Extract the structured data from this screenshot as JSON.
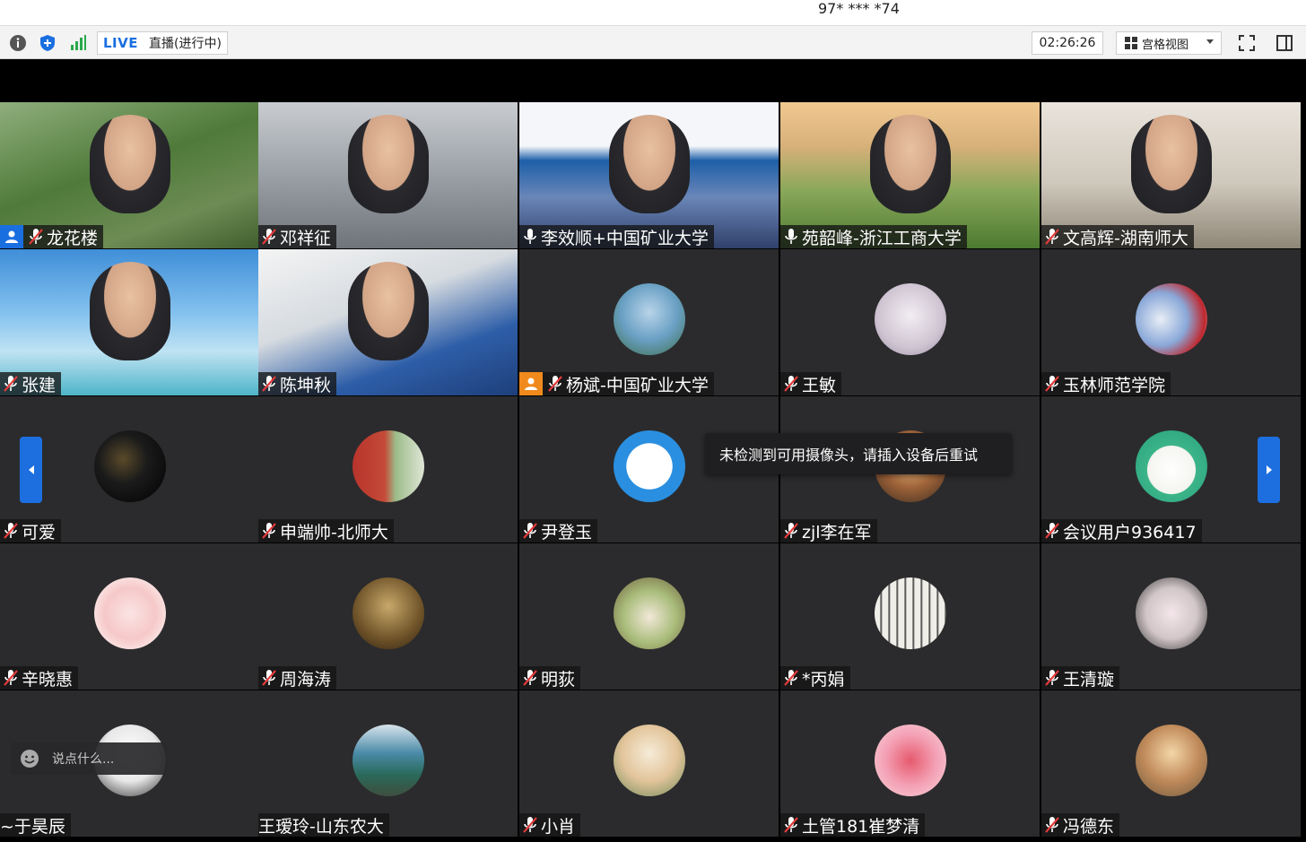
{
  "meeting_id": "97* *** *74",
  "toolbar": {
    "live_label": "LIVE",
    "live_status": "直播(进行中)",
    "timer": "02:26:26",
    "view_label": "宫格视图"
  },
  "tooltip": "未检测到可用摄像头，请插入设备后重试",
  "chat_placeholder": "说点什么...",
  "participants": [
    {
      "name": "龙花楼",
      "host": true,
      "host_color": "#1a6fe0",
      "mic": "muted",
      "video": true
    },
    {
      "name": "邓祥征",
      "mic": "muted",
      "video": true
    },
    {
      "name": "李效顺+中国矿业大学",
      "mic": "on",
      "video": true
    },
    {
      "name": "苑韶峰-浙江工商大学",
      "mic": "on",
      "video": true
    },
    {
      "name": "文高辉-湖南师大",
      "mic": "muted",
      "video": true
    },
    {
      "name": "张建",
      "mic": "muted",
      "video": true
    },
    {
      "name": "陈坤秋",
      "mic": "muted",
      "video": true
    },
    {
      "name": "杨斌-中国矿业大学",
      "host": true,
      "host_color": "#f08a1c",
      "mic": "muted",
      "video": false
    },
    {
      "name": "王敏",
      "mic": "muted",
      "video": false
    },
    {
      "name": "玉林师范学院",
      "mic": "muted",
      "video": false
    },
    {
      "name": "可爱",
      "mic": "muted",
      "video": false
    },
    {
      "name": "申端帅-北师大",
      "mic": "muted",
      "video": false
    },
    {
      "name": "尹登玉",
      "mic": "muted",
      "video": false
    },
    {
      "name": "zjl李在军",
      "mic": "muted",
      "video": false
    },
    {
      "name": "会议用户936417",
      "mic": "muted",
      "video": false
    },
    {
      "name": "辛晓惠",
      "mic": "muted",
      "video": false
    },
    {
      "name": "周海涛",
      "mic": "muted",
      "video": false
    },
    {
      "name": "明荻",
      "mic": "muted",
      "video": false
    },
    {
      "name": "*丙娟",
      "mic": "muted",
      "video": false
    },
    {
      "name": "王清璇",
      "mic": "muted",
      "video": false
    },
    {
      "name": "~于昊辰",
      "mic": "none",
      "video": false
    },
    {
      "name": "王瑷玲-山东农大",
      "mic": "none",
      "video": false
    },
    {
      "name": "小肖",
      "mic": "muted",
      "video": false
    },
    {
      "name": "土管181崔梦清",
      "mic": "muted",
      "video": false
    },
    {
      "name": "冯德东",
      "mic": "muted",
      "video": false
    }
  ]
}
